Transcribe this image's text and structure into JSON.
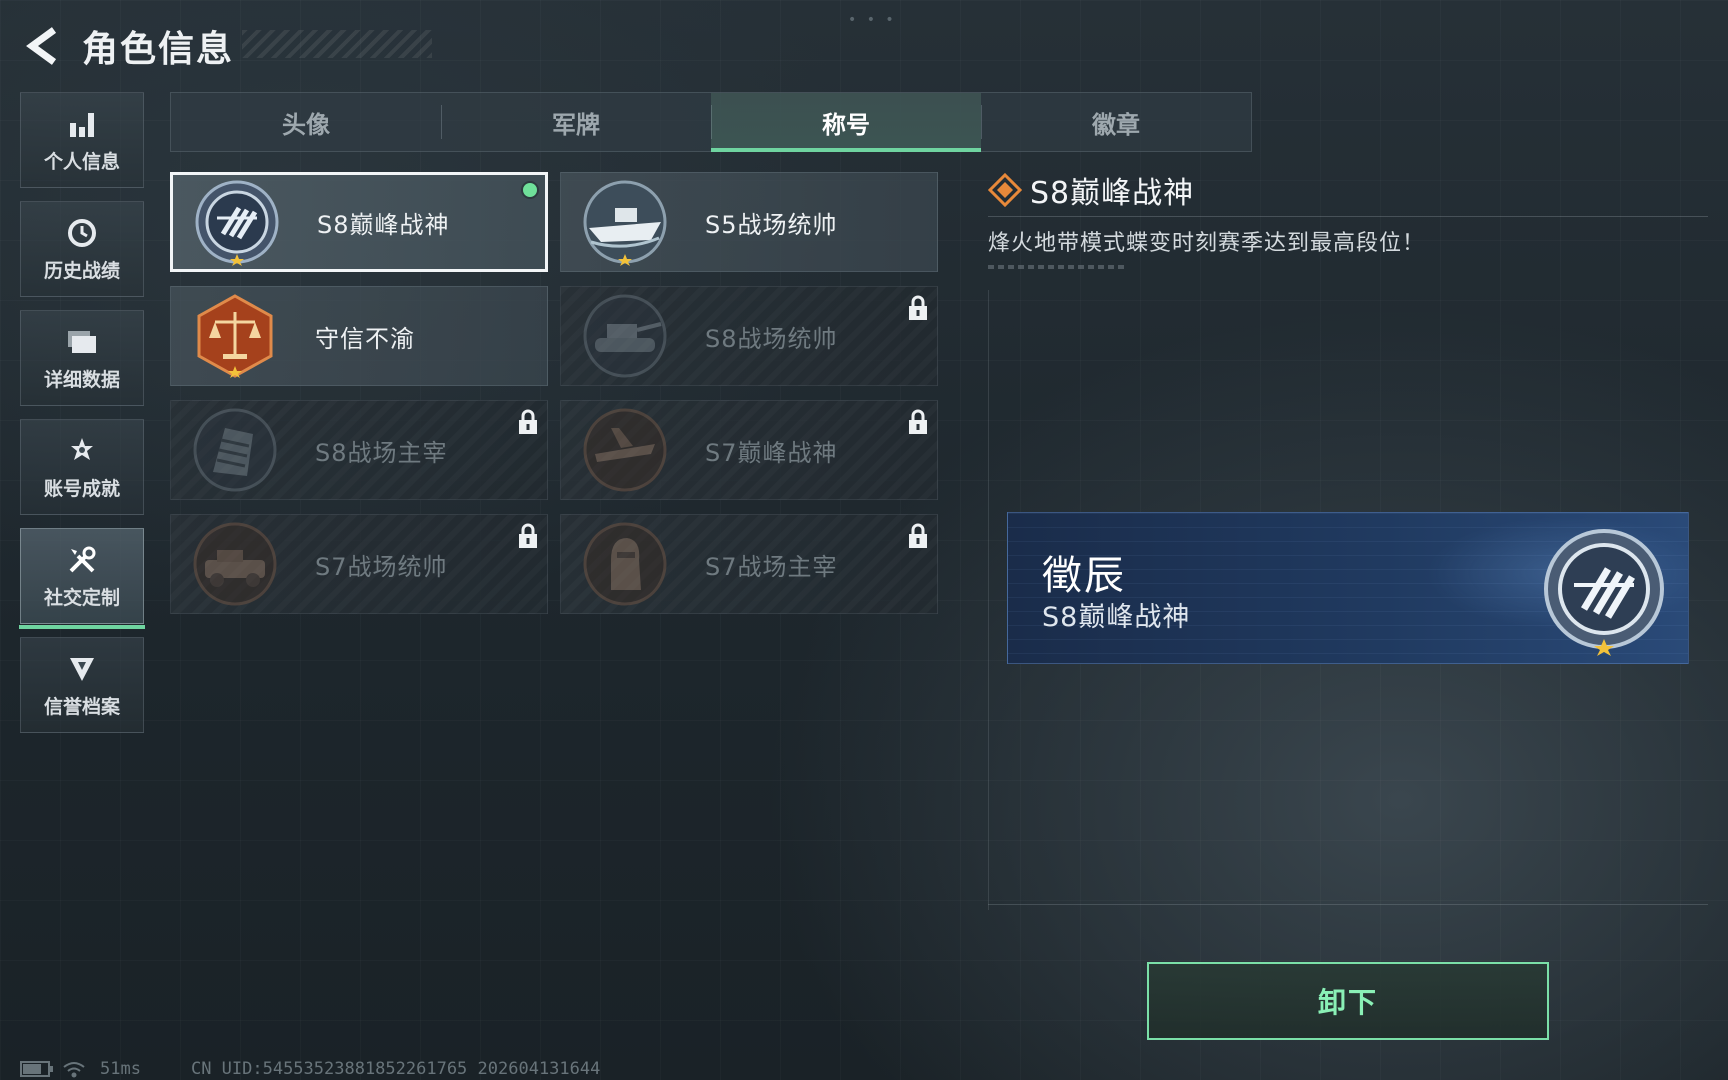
{
  "header": {
    "title": "角色信息"
  },
  "sidebar": {
    "items": [
      {
        "label": "个人信息",
        "icon": "bar-chart-icon",
        "active": false
      },
      {
        "label": "历史战绩",
        "icon": "history-clock-icon",
        "active": false
      },
      {
        "label": "详细数据",
        "icon": "folder-icon",
        "active": false
      },
      {
        "label": "账号成就",
        "icon": "achievement-star-icon",
        "active": false
      },
      {
        "label": "社交定制",
        "icon": "tools-icon",
        "active": true
      },
      {
        "label": "信誉档案",
        "icon": "credit-shield-icon",
        "active": false
      }
    ]
  },
  "tabs": [
    {
      "label": "头像",
      "active": false
    },
    {
      "label": "军牌",
      "active": false
    },
    {
      "label": "称号",
      "active": true
    },
    {
      "label": "徽章",
      "active": false
    }
  ],
  "titles": [
    {
      "label": "S8巅峰战神",
      "locked": false,
      "selected": true,
      "equipped": true,
      "badge": "peak-god-badge-icon"
    },
    {
      "label": "S5战场统帅",
      "locked": false,
      "selected": false,
      "equipped": false,
      "badge": "warship-badge-icon"
    },
    {
      "label": "守信不渝",
      "locked": false,
      "selected": false,
      "equipped": false,
      "badge": "scales-badge-icon"
    },
    {
      "label": "S8战场统帅",
      "locked": true,
      "selected": false,
      "equipped": false,
      "badge": "tank-badge-icon"
    },
    {
      "label": "S8战场主宰",
      "locked": true,
      "selected": false,
      "equipped": false,
      "badge": "building-badge-icon"
    },
    {
      "label": "S7巅峰战神",
      "locked": true,
      "selected": false,
      "equipped": false,
      "badge": "aircraft-badge-icon"
    },
    {
      "label": "S7战场统帅",
      "locked": true,
      "selected": false,
      "equipped": false,
      "badge": "vehicle-badge-icon"
    },
    {
      "label": "S7战场主宰",
      "locked": true,
      "selected": false,
      "equipped": false,
      "badge": "soldier-badge-icon"
    }
  ],
  "detail": {
    "title": "S8巅峰战神",
    "description": "烽火地带模式蝶变时刻赛季达到最高段位！"
  },
  "nameplate": {
    "player_name": "徵辰",
    "title": "S8巅峰战神"
  },
  "actions": {
    "unequip_label": "卸下"
  },
  "status": {
    "ping": "51ms",
    "uid": "CN UID:5455352388185226176​5 202604131644"
  },
  "colors": {
    "accent_green": "#6fd4a0",
    "button_green": "#7be0a8",
    "nameplate_blue": "#203a60",
    "diamond_orange": "#e8893a"
  }
}
